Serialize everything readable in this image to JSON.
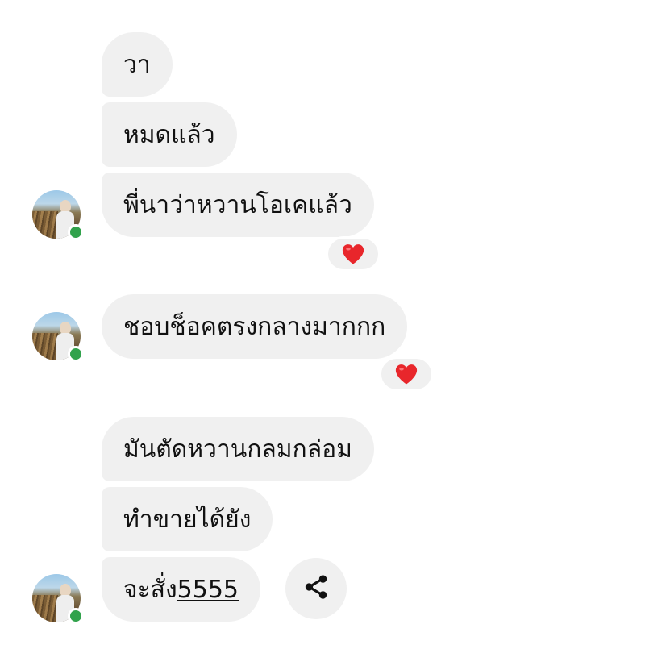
{
  "messages": {
    "m1": "วา",
    "m2": "หมดแล้ว",
    "m3": "พี่นาว่าหวานโอเคแล้ว",
    "m4": "ชอบช็อคตรงกลางมากกก",
    "m5": "มันตัดหวานกลมกล่อม",
    "m6": "ทำขายได้ยัง",
    "m7_prefix": "จะสั่ง",
    "m7_link": "5555"
  },
  "reactions": {
    "r1": "heart-icon",
    "r2": "heart-icon"
  },
  "colors": {
    "bubble": "#f0f0f0",
    "online": "#31a24c",
    "heart": "#e8262b"
  }
}
